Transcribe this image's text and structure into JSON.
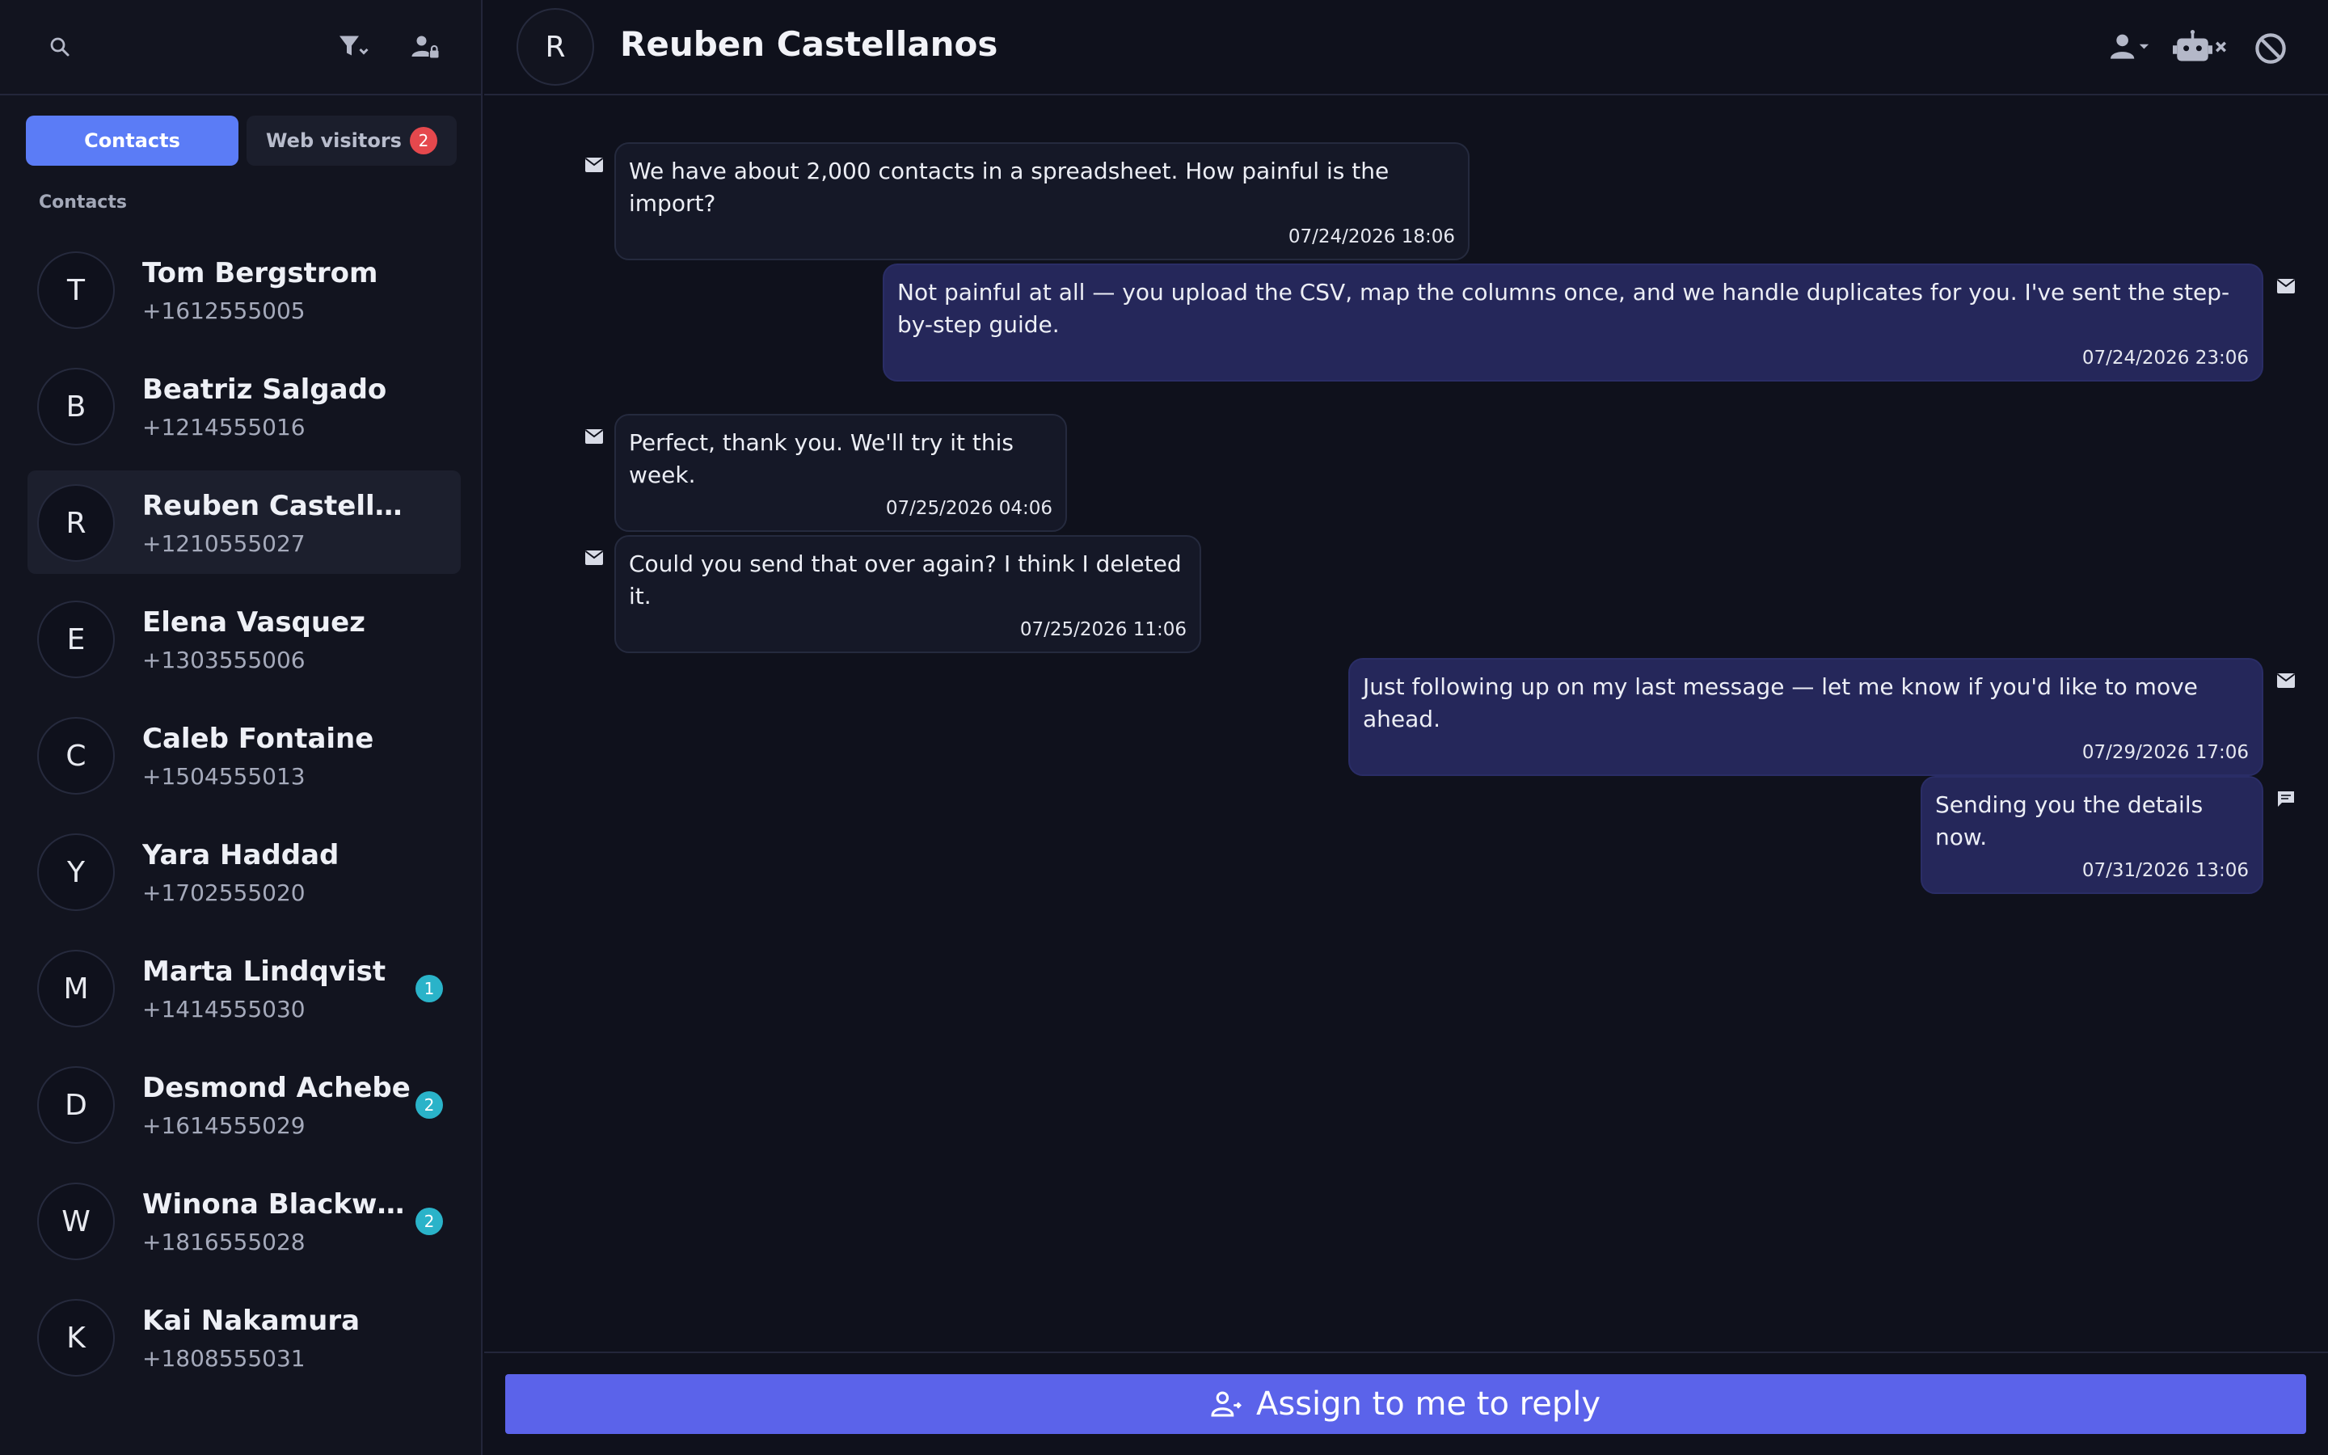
{
  "sidebar": {
    "tabs": {
      "contacts_label": "Contacts",
      "web_visitors_label": "Web visitors",
      "web_visitors_count": "2"
    },
    "section_label": "Contacts",
    "contacts": [
      {
        "initial": "T",
        "name": "Tom Bergstrom",
        "phone": "+1612555005",
        "unread": ""
      },
      {
        "initial": "B",
        "name": "Beatriz Salgado",
        "phone": "+1214555016",
        "unread": ""
      },
      {
        "initial": "R",
        "name": "Reuben Castella...",
        "phone": "+1210555027",
        "unread": "",
        "active": true
      },
      {
        "initial": "E",
        "name": "Elena Vasquez",
        "phone": "+1303555006",
        "unread": ""
      },
      {
        "initial": "C",
        "name": "Caleb Fontaine",
        "phone": "+1504555013",
        "unread": ""
      },
      {
        "initial": "Y",
        "name": "Yara Haddad",
        "phone": "+1702555020",
        "unread": ""
      },
      {
        "initial": "M",
        "name": "Marta Lindqvist",
        "phone": "+1414555030",
        "unread": "1"
      },
      {
        "initial": "D",
        "name": "Desmond Achebe",
        "phone": "+1614555029",
        "unread": "2"
      },
      {
        "initial": "W",
        "name": "Winona Blackwoo...",
        "phone": "+1816555028",
        "unread": "2"
      },
      {
        "initial": "K",
        "name": "Kai Nakamura",
        "phone": "+1808555031",
        "unread": ""
      }
    ]
  },
  "header": {
    "avatar_initial": "R",
    "title": "Reuben Castellanos"
  },
  "messages": [
    {
      "direction": "in",
      "channel": "mail-icon",
      "text": "We have about 2,000 contacts in a spreadsheet. How painful is the import?",
      "time": "07/24/2026 18:06"
    },
    {
      "direction": "out",
      "channel": "mail-icon",
      "text": "Not painful at all — you upload the CSV, map the columns once, and we handle duplicates for you. I've sent the step-by-step guide.",
      "time": "07/24/2026 23:06"
    },
    {
      "direction": "in",
      "channel": "mail-icon",
      "text": "Perfect, thank you. We'll try it this week.",
      "time": "07/25/2026 04:06"
    },
    {
      "direction": "in",
      "channel": "mail-icon",
      "text": "Could you send that over again? I think I deleted it.",
      "time": "07/25/2026 11:06"
    },
    {
      "direction": "out",
      "channel": "mail-icon",
      "text": "Just following up on my last message — let me know if you'd like to move ahead.",
      "time": "07/29/2026 17:06"
    },
    {
      "direction": "out",
      "channel": "chat-icon",
      "text": "Sending you the details now.",
      "time": "07/31/2026 13:06"
    }
  ],
  "composer": {
    "assign_label": "Assign to me to reply"
  },
  "colors": {
    "accent": "#5b7cf6",
    "assign_button": "#5b63ea",
    "unread_badge": "#2ab3c9",
    "web_visitors_badge": "#e5484d"
  }
}
